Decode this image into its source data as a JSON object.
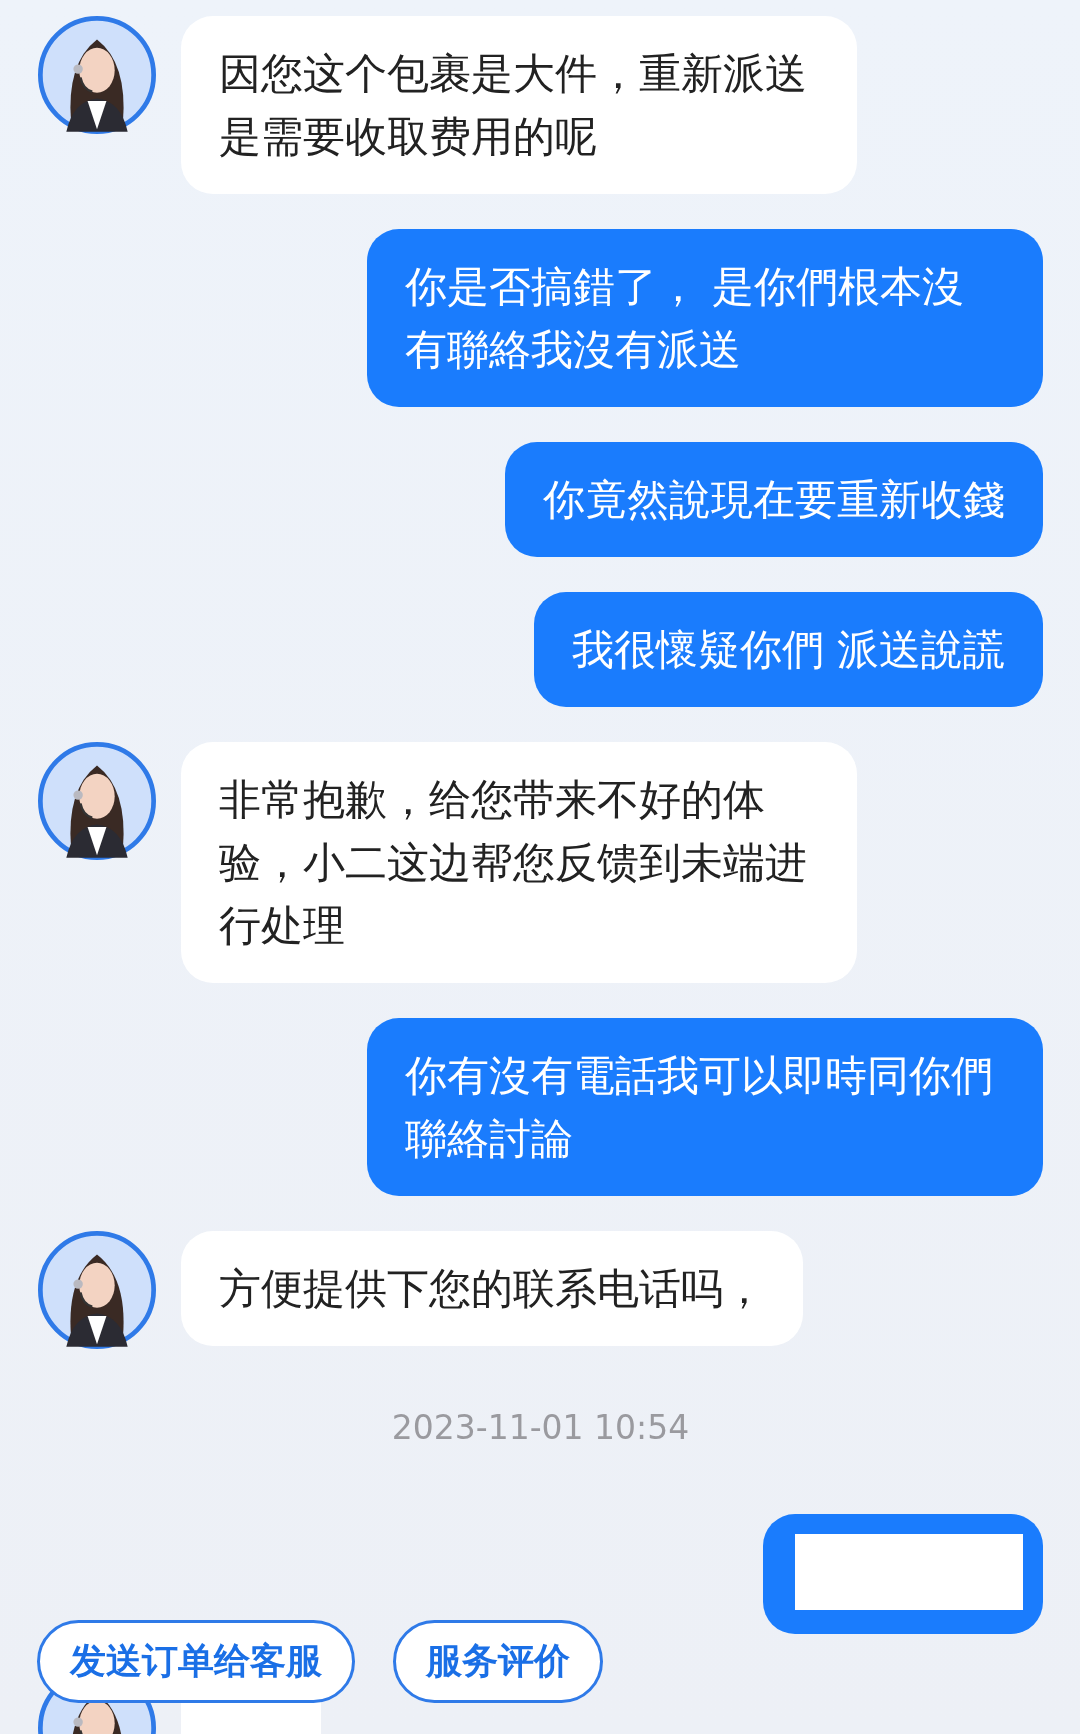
{
  "messages": [
    {
      "kind": "agent",
      "text": "因您这个包裹是大件，重新派送是需要收取费用的呢"
    },
    {
      "kind": "user",
      "text": "你是否搞錯了， 是你們根本沒有聯絡我沒有派送"
    },
    {
      "kind": "user",
      "text": "你竟然說現在要重新收錢"
    },
    {
      "kind": "user",
      "text": "我很懷疑你們 派送說謊"
    },
    {
      "kind": "agent",
      "text": "非常抱歉，给您带来不好的体验，小二这边帮您反馈到未端进行处理"
    },
    {
      "kind": "user",
      "text": "你有沒有電話我可以即時同你們聯絡討論"
    },
    {
      "kind": "agent",
      "text": "方便提供下您的联系电话吗，"
    },
    {
      "kind": "time",
      "text": "2023-11-01 10:54"
    },
    {
      "kind": "user_redacted"
    },
    {
      "kind": "agent_partial"
    }
  ],
  "quick_actions": [
    "发送订单给客服",
    "服务评价"
  ]
}
